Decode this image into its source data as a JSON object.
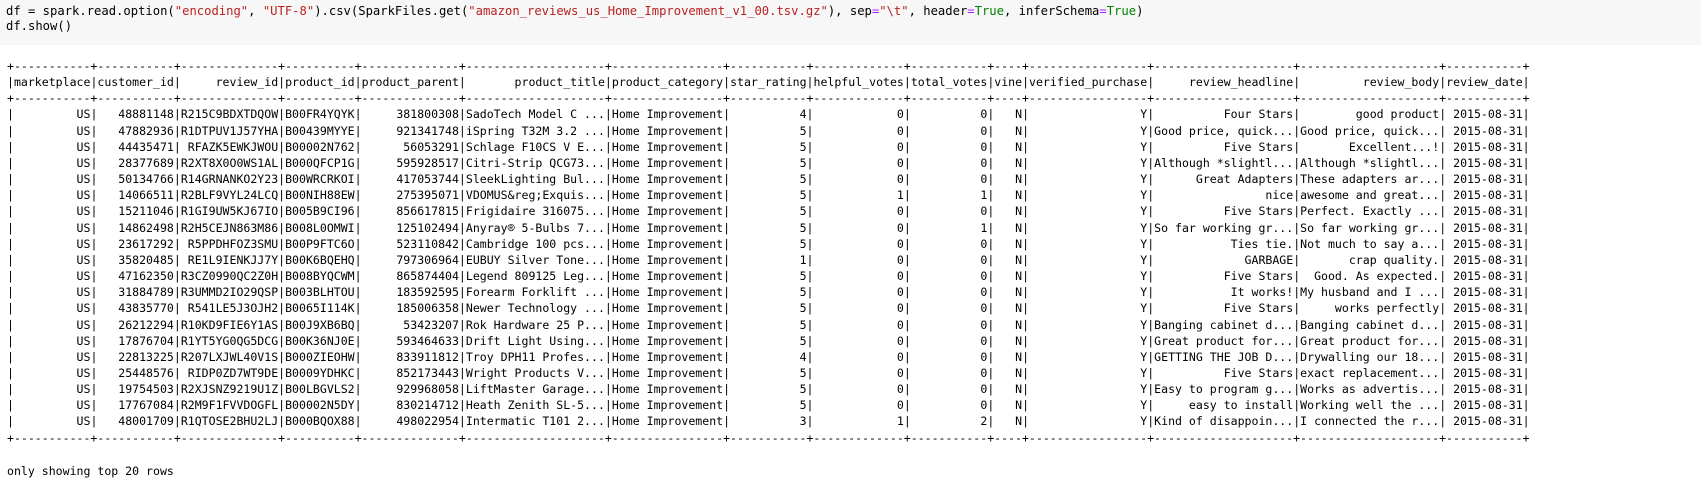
{
  "code_cell": {
    "line1": {
      "p1": "df = spark.read.option(",
      "s1": "\"encoding\"",
      "p2": ", ",
      "s2": "\"UTF-8\"",
      "p3": ").csv(SparkFiles.get(",
      "s3": "\"amazon_reviews_us_Home_Improvement_v1_00.tsv.gz\"",
      "p4": "), sep",
      "eq1": "=",
      "s4": "\"\\t\"",
      "p5": ", header",
      "eq2": "=",
      "k1": "True",
      "p6": ", inferSchema",
      "eq3": "=",
      "k2": "True",
      "p7": ")"
    },
    "line2": "df.show()"
  },
  "output": {
    "columns": [
      "marketplace",
      "customer_id",
      "review_id",
      "product_id",
      "product_parent",
      "product_title",
      "product_category",
      "star_rating",
      "helpful_votes",
      "total_votes",
      "vine",
      "verified_purchase",
      "review_headline",
      "review_body",
      "review_date"
    ],
    "rows": [
      [
        "US",
        "48881148",
        "R215C9BDXTDQOW",
        "B00FR4YQYK",
        "381800308",
        "SadoTech Model C ...",
        "Home Improvement",
        "4",
        "0",
        "0",
        "N",
        "Y",
        "Four Stars",
        "good product",
        "2015-08-31"
      ],
      [
        "US",
        "47882936",
        "R1DTPUV1J57YHA",
        "B00439MYYE",
        "921341748",
        "iSpring T32M 3.2 ...",
        "Home Improvement",
        "5",
        "0",
        "0",
        "N",
        "Y",
        "Good price, quick...",
        "Good price, quick...",
        "2015-08-31"
      ],
      [
        "US",
        "44435471",
        "RFAZK5EWKJWOU",
        "B00002N762",
        "56053291",
        "Schlage F10CS V E...",
        "Home Improvement",
        "5",
        "0",
        "0",
        "N",
        "Y",
        "Five Stars",
        "Excellent...!",
        "2015-08-31"
      ],
      [
        "US",
        "28377689",
        "R2XT8X0O0WS1AL",
        "B000QFCP1G",
        "595928517",
        "Citri-Strip QCG73...",
        "Home Improvement",
        "5",
        "0",
        "0",
        "N",
        "Y",
        "Although *slightl...",
        "Although *slightl...",
        "2015-08-31"
      ],
      [
        "US",
        "50134766",
        "R14GRNANKO2Y23",
        "B00WRCRKOI",
        "417053744",
        "SleekLighting Bul...",
        "Home Improvement",
        "5",
        "0",
        "0",
        "N",
        "Y",
        "Great Adapters",
        "These adapters ar...",
        "2015-08-31"
      ],
      [
        "US",
        "14066511",
        "R2BLF9VYL24LCQ",
        "B00NIH88EW",
        "275395071",
        "VDOMUS&reg;Exquis...",
        "Home Improvement",
        "5",
        "1",
        "1",
        "N",
        "Y",
        "nice",
        "awesome and great...",
        "2015-08-31"
      ],
      [
        "US",
        "15211046",
        "R1GI9UW5KJ67IO",
        "B005B9CI96",
        "856617815",
        "Frigidaire 316075...",
        "Home Improvement",
        "5",
        "0",
        "0",
        "N",
        "Y",
        "Five Stars",
        "Perfect. Exactly ...",
        "2015-08-31"
      ],
      [
        "US",
        "14862498",
        "R2H5CEJN863M86",
        "B008L0OMWI",
        "125102494",
        "Anyray® 5-Bulbs 7...",
        "Home Improvement",
        "5",
        "0",
        "1",
        "N",
        "Y",
        "So far working gr...",
        "So far working gr...",
        "2015-08-31"
      ],
      [
        "US",
        "23617292",
        "R5PPDHFOZ3SMU",
        "B00P9FTC6O",
        "523110842",
        "Cambridge 100 pcs...",
        "Home Improvement",
        "5",
        "0",
        "0",
        "N",
        "Y",
        "Ties tie.",
        "Not much to say a...",
        "2015-08-31"
      ],
      [
        "US",
        "35820485",
        "RE1L9IENKJJ7Y",
        "B00K6BQEHQ",
        "797306964",
        "EUBUY Silver Tone...",
        "Home Improvement",
        "1",
        "0",
        "0",
        "N",
        "Y",
        "GARBAGE",
        "crap quality.",
        "2015-08-31"
      ],
      [
        "US",
        "47162350",
        "R3CZ0990QC2Z0H",
        "B008BYQCWM",
        "865874404",
        "Legend 809125 Leg...",
        "Home Improvement",
        "5",
        "0",
        "0",
        "N",
        "Y",
        "Five Stars",
        "Good. As expected.",
        "2015-08-31"
      ],
      [
        "US",
        "31884789",
        "R3UMMD2IO29QSP",
        "B003BLHTOU",
        "183592595",
        "Forearm Forklift ...",
        "Home Improvement",
        "5",
        "0",
        "0",
        "N",
        "Y",
        "It works!",
        "My husband and I ...",
        "2015-08-31"
      ],
      [
        "US",
        "43835770",
        "R541LE5J3OJH2",
        "B0065I114K",
        "185006358",
        "Newer Technology ...",
        "Home Improvement",
        "5",
        "0",
        "0",
        "N",
        "Y",
        "Five Stars",
        "works perfectly",
        "2015-08-31"
      ],
      [
        "US",
        "26212294",
        "R10KD9FIE6Y1AS",
        "B00J9XB6BQ",
        "53423207",
        "Rok Hardware 25 P...",
        "Home Improvement",
        "5",
        "0",
        "0",
        "N",
        "Y",
        "Banging cabinet d...",
        "Banging cabinet d...",
        "2015-08-31"
      ],
      [
        "US",
        "17876704",
        "R1YT5YG0QG5DCG",
        "B00K36NJ0E",
        "593464633",
        "Drift Light Using...",
        "Home Improvement",
        "5",
        "0",
        "0",
        "N",
        "Y",
        "Great product for...",
        "Great product for...",
        "2015-08-31"
      ],
      [
        "US",
        "22813225",
        "R207LXJWL40V1S",
        "B000ZIEOHW",
        "833911812",
        "Troy DPH11 Profes...",
        "Home Improvement",
        "4",
        "0",
        "0",
        "N",
        "Y",
        "GETTING THE JOB D...",
        "Drywalling our 18...",
        "2015-08-31"
      ],
      [
        "US",
        "25448576",
        "RIDP0ZD7WT9DE",
        "B0009YDHKC",
        "852173443",
        "Wright Products V...",
        "Home Improvement",
        "5",
        "0",
        "0",
        "N",
        "Y",
        "Five Stars",
        "exact replacement...",
        "2015-08-31"
      ],
      [
        "US",
        "19754503",
        "R2XJSNZ9219U1Z",
        "B00LBGVLS2",
        "929968058",
        "LiftMaster Garage...",
        "Home Improvement",
        "5",
        "0",
        "0",
        "N",
        "Y",
        "Easy to program g...",
        "Works as advertis...",
        "2015-08-31"
      ],
      [
        "US",
        "17767084",
        "R2M9F1FVVDOGFL",
        "B00002N5DY",
        "830214712",
        "Heath Zenith SL-5...",
        "Home Improvement",
        "5",
        "0",
        "0",
        "N",
        "Y",
        "easy to install",
        "Working well the ...",
        "2015-08-31"
      ],
      [
        "US",
        "48001709",
        "R1QTOSE2BHU2LJ",
        "B000BQOX88",
        "498022954",
        "Intermatic T101 2...",
        "Home Improvement",
        "3",
        "1",
        "2",
        "N",
        "Y",
        "Kind of disappoin...",
        "I connected the r...",
        "2015-08-31"
      ]
    ],
    "footer": "only showing top 20 rows"
  }
}
